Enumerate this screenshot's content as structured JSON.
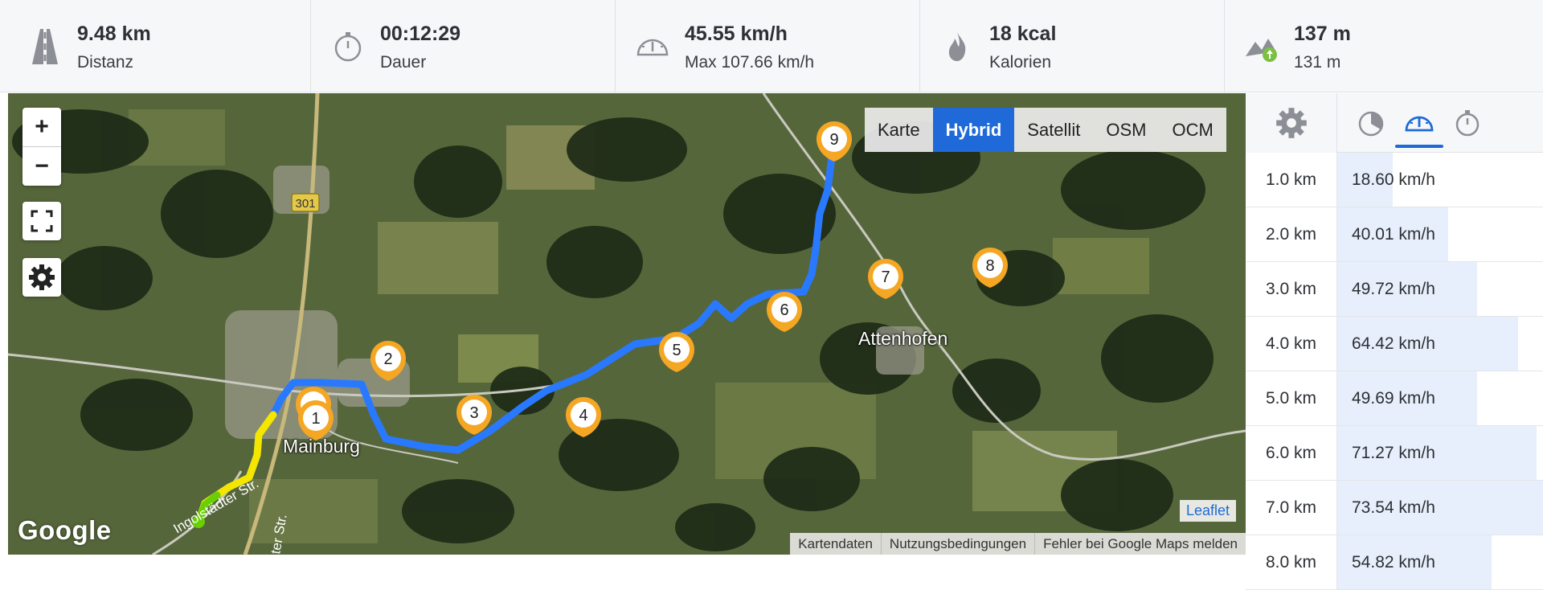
{
  "stats": [
    {
      "icon": "road-icon",
      "value": "9.48 km",
      "label": "Distanz"
    },
    {
      "icon": "stopwatch-icon",
      "value": "00:12:29",
      "label": "Dauer"
    },
    {
      "icon": "speedometer-icon",
      "value": "45.55 km/h",
      "label": "Max 107.66 km/h"
    },
    {
      "icon": "flame-icon",
      "value": "18 kcal",
      "label": "Kalorien"
    },
    {
      "icon": "elevation-icon",
      "value": "137 m",
      "label": "131 m"
    }
  ],
  "map": {
    "zoom_in": "+",
    "zoom_out": "−",
    "layers": [
      "Karte",
      "Hybrid",
      "Satellit",
      "OSM",
      "OCM"
    ],
    "active_layer": "Hybrid",
    "towns": {
      "marburg": "Mainburg",
      "attenhofen": "Attenhofen"
    },
    "road_label": "301",
    "street_label_1": "Ingolstädter Str.",
    "street_label_2": "ter Str.",
    "google": "Google",
    "leaflet": "Leaflet",
    "attribution": [
      "Kartendaten",
      "Nutzungsbedingungen",
      "Fehler bei Google Maps melden"
    ],
    "markers": [
      "1",
      "2",
      "3",
      "4",
      "5",
      "6",
      "7",
      "8",
      "9"
    ]
  },
  "splits": {
    "tabs": [
      "pace-icon",
      "speedometer-icon",
      "stopwatch-icon"
    ],
    "active_tab": "speedometer-icon",
    "rows": [
      {
        "km": "1.0 km",
        "speed": "18.60 km/h",
        "fraction": 0.27
      },
      {
        "km": "2.0 km",
        "speed": "40.01 km/h",
        "fraction": 0.54
      },
      {
        "km": "3.0 km",
        "speed": "49.72 km/h",
        "fraction": 0.68
      },
      {
        "km": "4.0 km",
        "speed": "64.42 km/h",
        "fraction": 0.88
      },
      {
        "km": "5.0 km",
        "speed": "49.69 km/h",
        "fraction": 0.68
      },
      {
        "km": "6.0 km",
        "speed": "71.27 km/h",
        "fraction": 0.97
      },
      {
        "km": "7.0 km",
        "speed": "73.54 km/h",
        "fraction": 1.0
      },
      {
        "km": "8.0 km",
        "speed": "54.82 km/h",
        "fraction": 0.75
      }
    ]
  },
  "colors": {
    "accent": "#1f6ad8",
    "route": "#2979ff",
    "marker": "#f5a623"
  }
}
